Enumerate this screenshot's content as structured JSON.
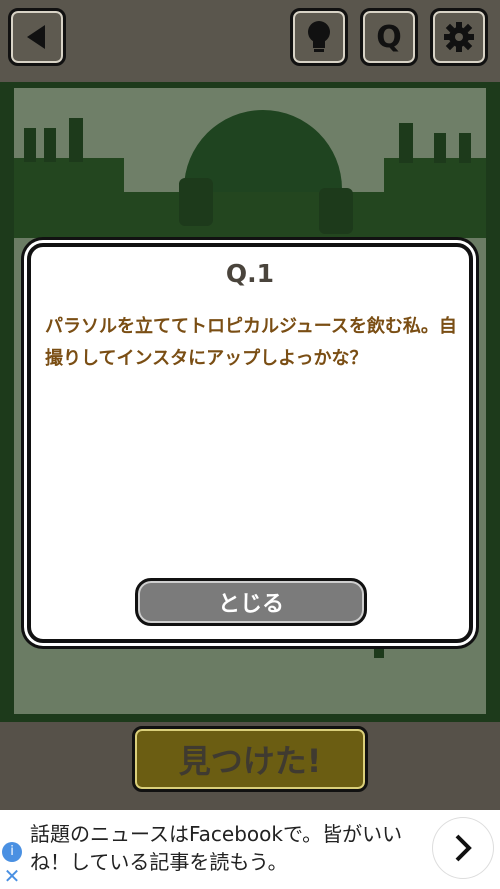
{
  "header": {
    "back_icon": "back-triangle-icon",
    "hint_icon": "lightbulb-icon",
    "question_button_label": "Q",
    "settings_icon": "gear-icon"
  },
  "modal": {
    "title": "Q.1",
    "text": "パラソルを立ててトロピカルジュースを飲む私。自撮りしてインスタにアップしよっかな？",
    "close_label": "とじる"
  },
  "found_button": {
    "label": "見つけた!"
  },
  "ad": {
    "text": "話題のニュースはFacebookで。皆がいいね！している記事を読もう。",
    "info_icon": "info-icon",
    "close_icon": "close-icon",
    "arrow_icon": "chevron-right-icon"
  },
  "colors": {
    "modal_text": "#7a4e14",
    "found_button": "#6b5d12",
    "close_button": "#7b7b7b"
  }
}
